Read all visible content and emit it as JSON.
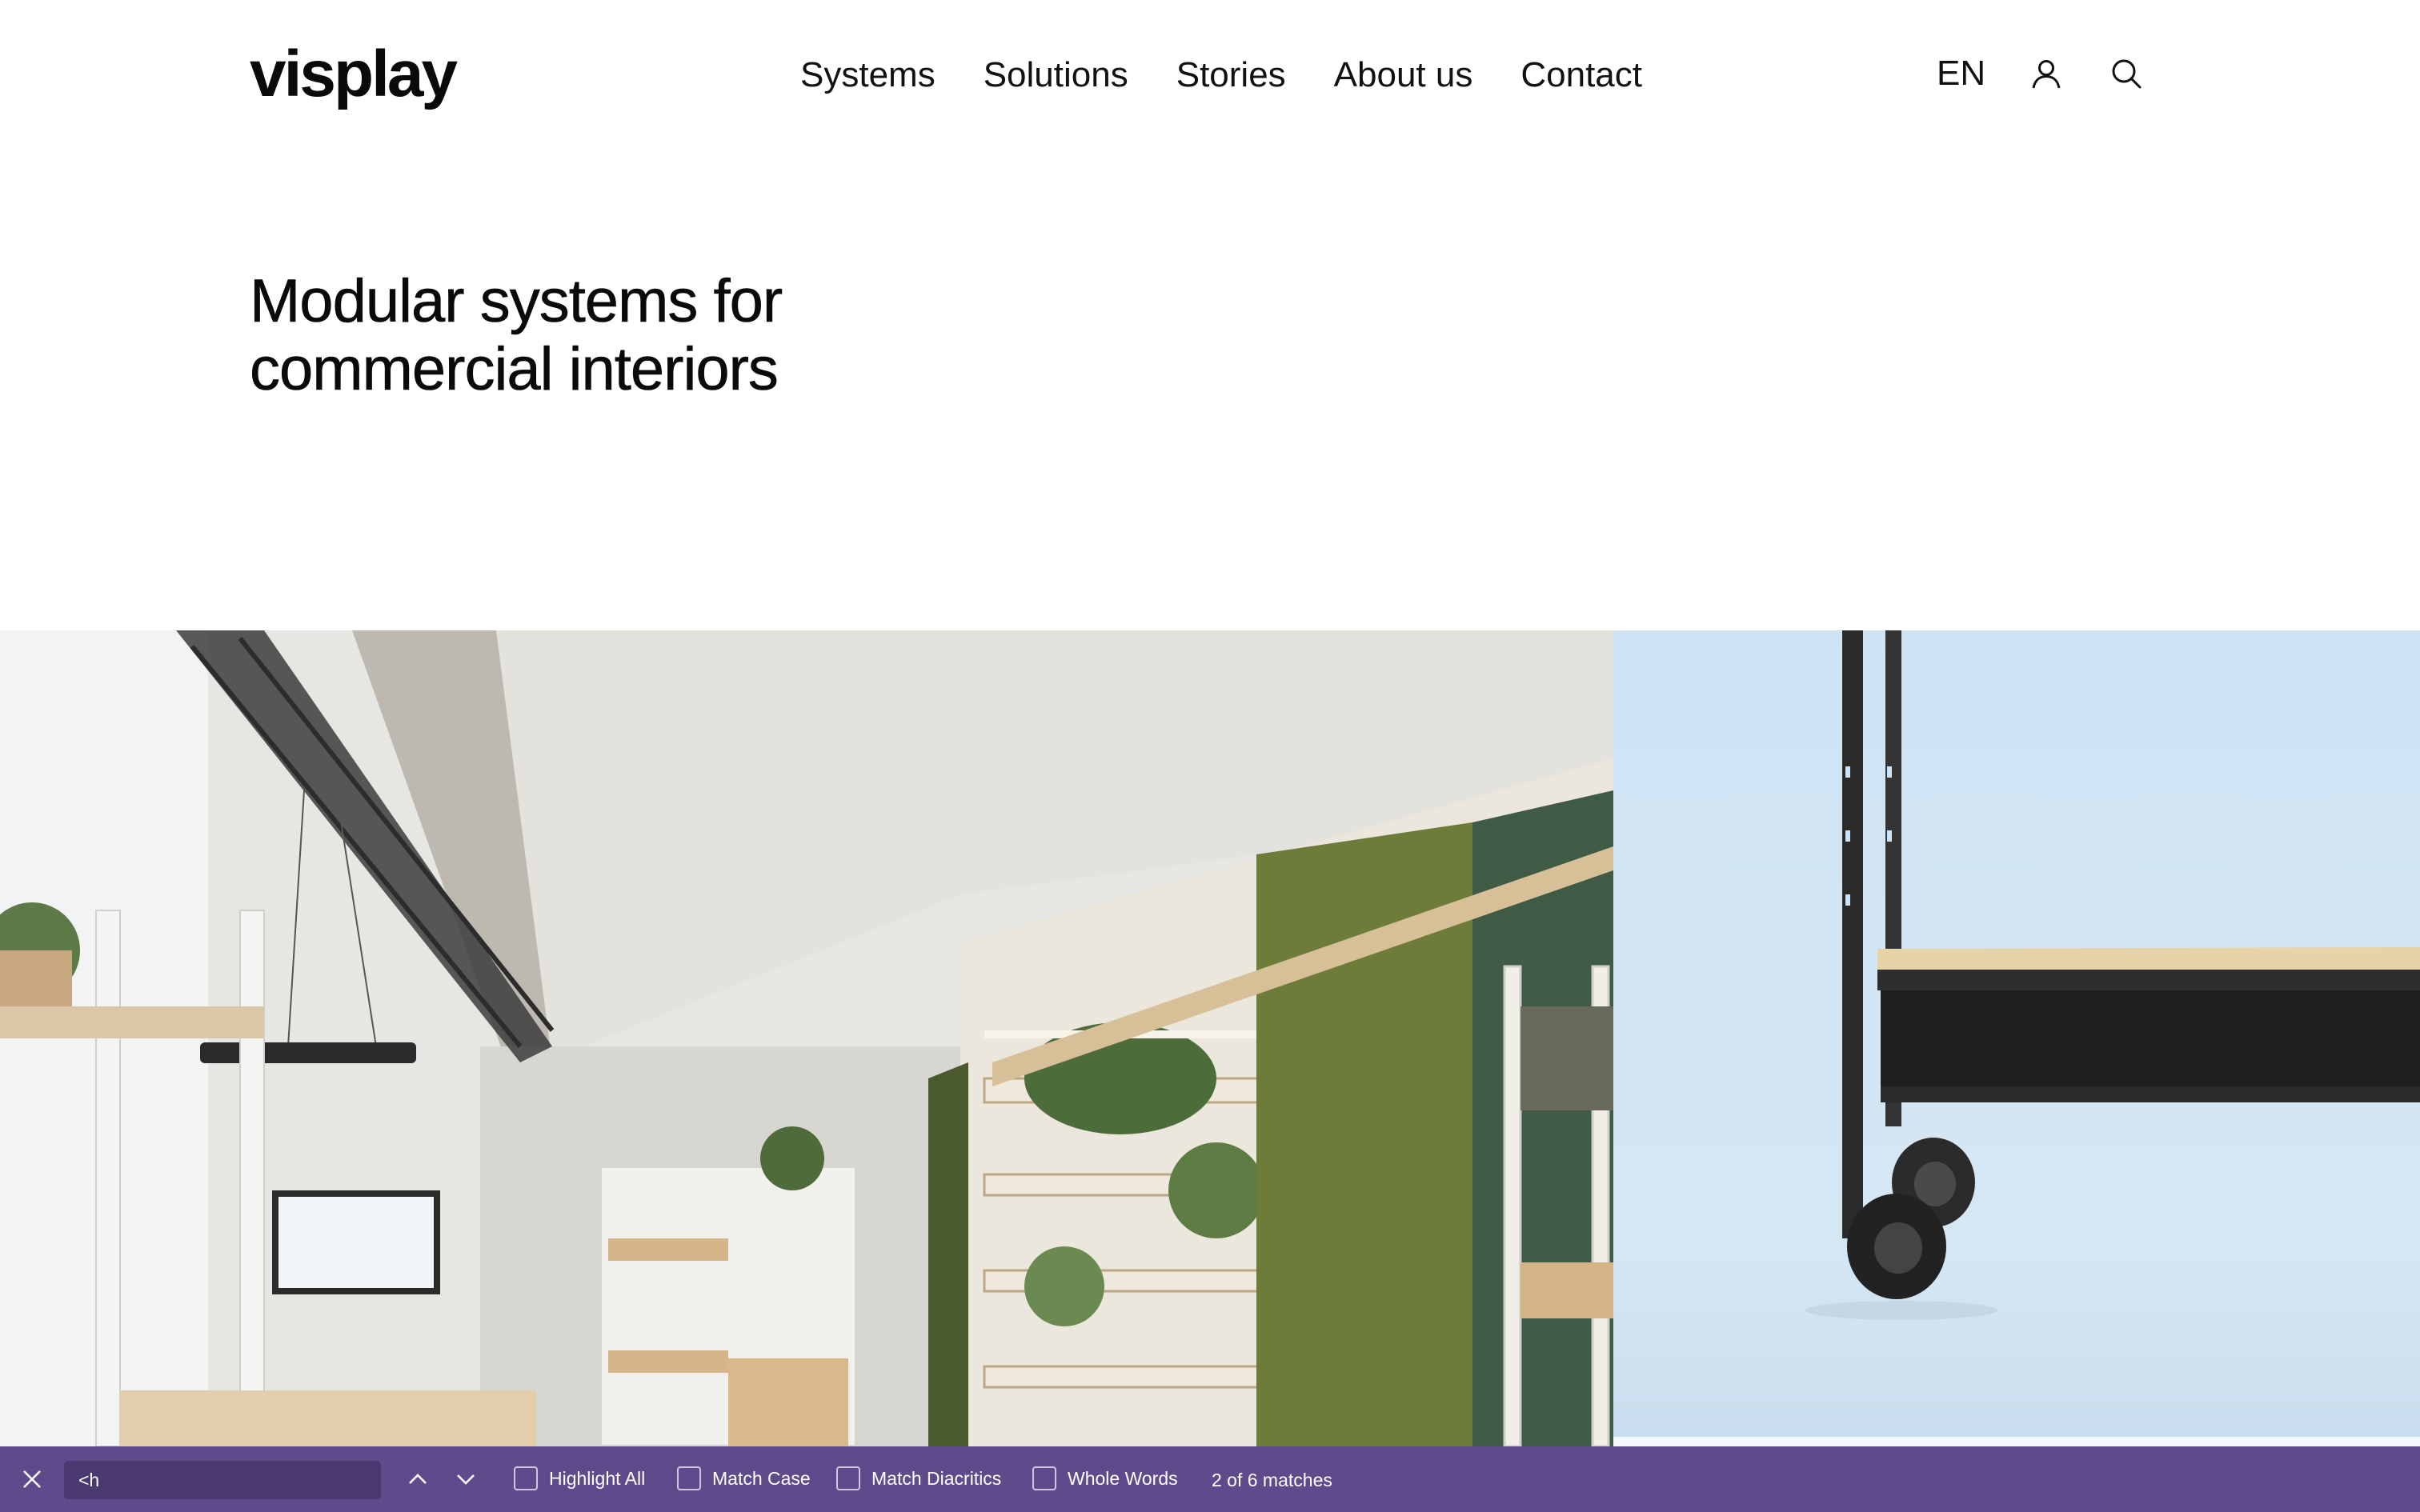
{
  "header": {
    "logo": "visplay",
    "nav": [
      "Systems",
      "Solutions",
      "Stories",
      "About us",
      "Contact"
    ],
    "language": "EN",
    "icons": [
      "user-icon",
      "search-icon"
    ]
  },
  "hero": {
    "title_line1": "Modular systems for",
    "title_line2": "commercial interiors"
  },
  "gallery": {
    "images": [
      {
        "name": "office-interior-photo"
      },
      {
        "name": "shelving-cart-photo"
      }
    ]
  },
  "findbar": {
    "query": "<h",
    "options": [
      "Highlight All",
      "Match Case",
      "Match Diacritics",
      "Whole Words"
    ],
    "status": "2 of 6 matches",
    "icons": [
      "close-icon",
      "chevron-up-icon",
      "chevron-down-icon"
    ],
    "colors": {
      "background": "#5f4b8b",
      "input": "#4a3870"
    }
  }
}
